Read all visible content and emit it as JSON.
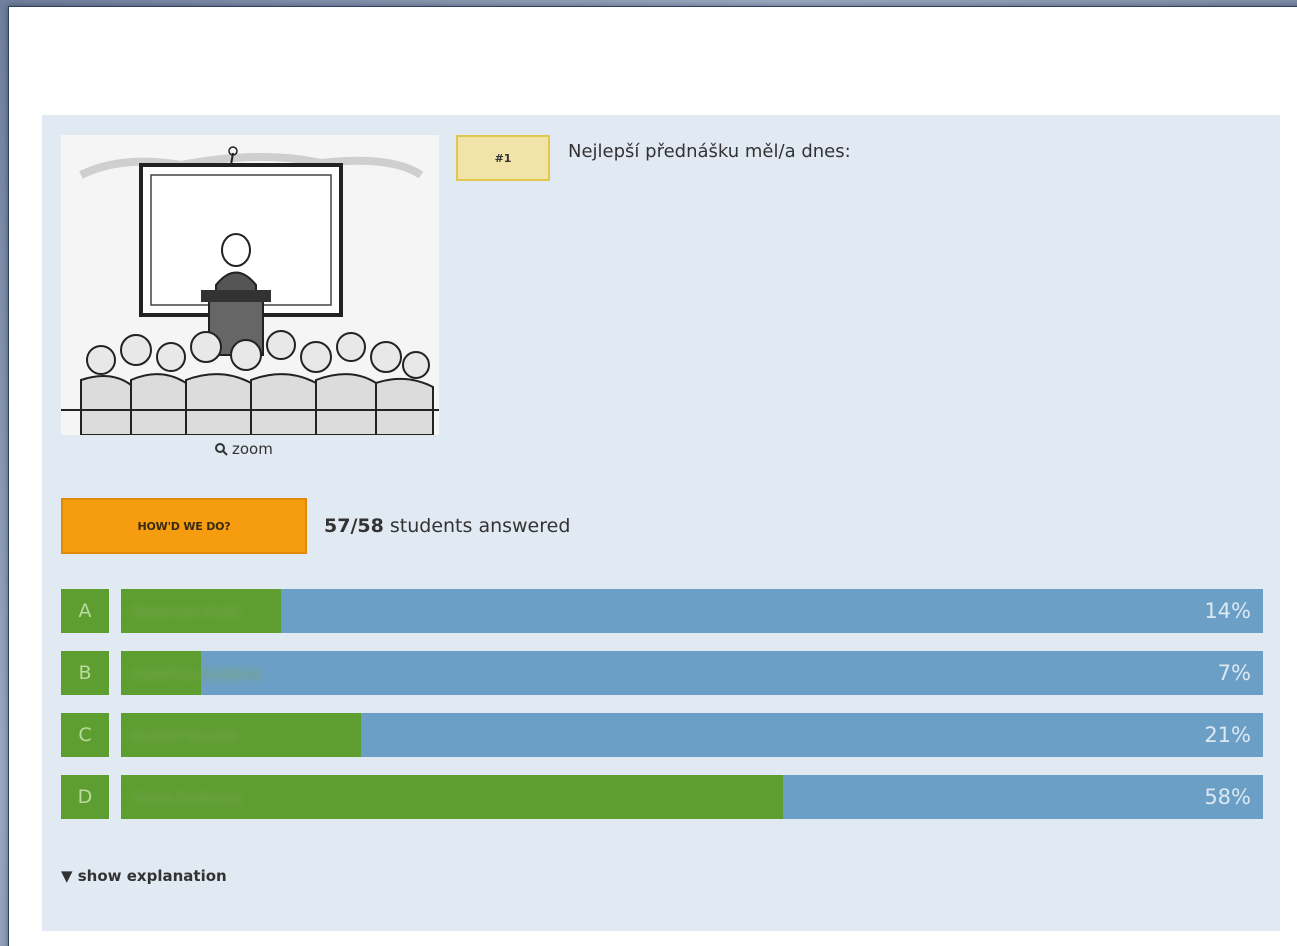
{
  "question": {
    "number_label": "#1",
    "text": "Nejlepší přednášku měl/a dnes:",
    "zoom_label": "zoom"
  },
  "results": {
    "button_label": "HOW'D WE DO?",
    "answered_count": "57/58",
    "answered_suffix": " students answered"
  },
  "answers": [
    {
      "letter": "A",
      "name": "Radovan Kraļil",
      "percent_label": "14%",
      "percent": 14
    },
    {
      "letter": "B",
      "name": "Kateřina Kuldová",
      "percent_label": "7%",
      "percent": 7
    },
    {
      "letter": "C",
      "name": "Rudolf Doudej",
      "percent_label": "21%",
      "percent": 21
    },
    {
      "letter": "D",
      "name": "Hana Svoboda",
      "percent_label": "58%",
      "percent": 58
    }
  ],
  "explanation_toggle": "▼ show explanation",
  "colors": {
    "panel": "#e1e9f3",
    "bar_blue": "#6c9fc6",
    "bar_green": "#5e9e30",
    "button_orange": "#f59d0e",
    "number_badge": "#f2e4a8"
  }
}
